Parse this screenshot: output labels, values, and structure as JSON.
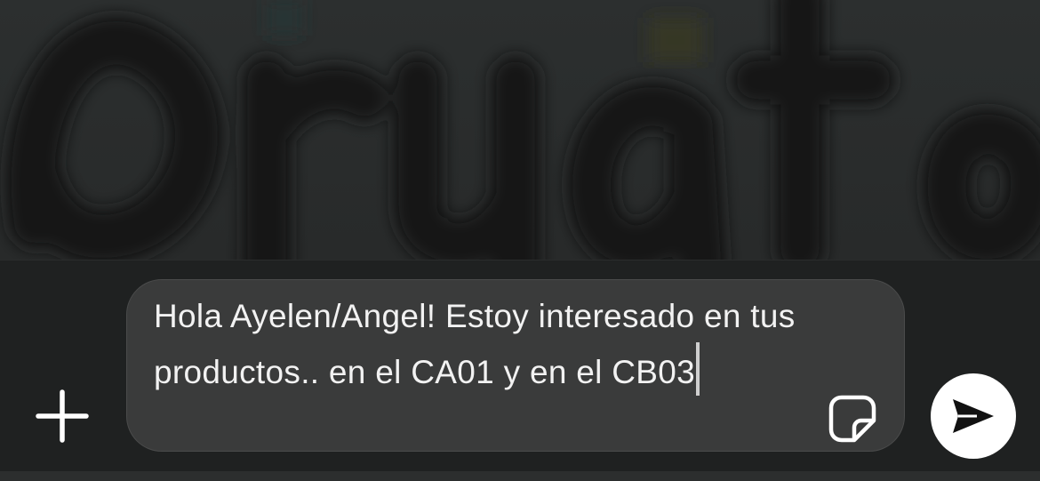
{
  "composer": {
    "message_text": "Hola Ayelen/Angel! Estoy interesado en tus productos.. en el CA01 y en el CB03",
    "add_icon": "plus-icon",
    "sticker_icon": "sticker-icon",
    "send_icon": "send-arrow-icon"
  },
  "colors": {
    "bar_background": "#1f2121",
    "input_background": "#3a3b3b",
    "text": "#f2f2f2",
    "send_button": "#ffffff"
  }
}
